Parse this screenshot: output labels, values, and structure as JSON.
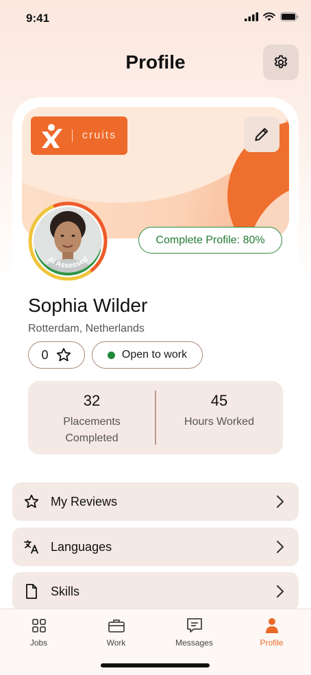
{
  "status_bar": {
    "time": "9:41"
  },
  "header": {
    "title": "Profile"
  },
  "banner": {
    "logo_text": "cruits",
    "complete_profile": "Complete Profile: 80%",
    "profile_completion": 0.8
  },
  "avatar": {
    "badge": "AI Assessed"
  },
  "profile": {
    "name": "Sophia Wilder",
    "location": "Rotterdam, Netherlands",
    "rating": "0",
    "status": "Open to work"
  },
  "stats": [
    {
      "value": "32",
      "label_line1": "Placements",
      "label_line2": "Completed"
    },
    {
      "value": "45",
      "label_line1": "Hours Worked",
      "label_line2": ""
    }
  ],
  "menu": [
    {
      "label": "My Reviews",
      "icon": "star-icon"
    },
    {
      "label": "Languages",
      "icon": "translate-icon"
    },
    {
      "label": "Skills",
      "icon": "document-icon"
    }
  ],
  "tabs": [
    {
      "label": "Jobs",
      "icon": "grid-icon"
    },
    {
      "label": "Work",
      "icon": "briefcase-icon"
    },
    {
      "label": "Messages",
      "icon": "chat-icon"
    },
    {
      "label": "Profile",
      "icon": "person-icon",
      "active": true
    }
  ],
  "colors": {
    "accent": "#ee6a2b",
    "success": "#2c8b3e",
    "card_bg": "#f4e9e4"
  }
}
